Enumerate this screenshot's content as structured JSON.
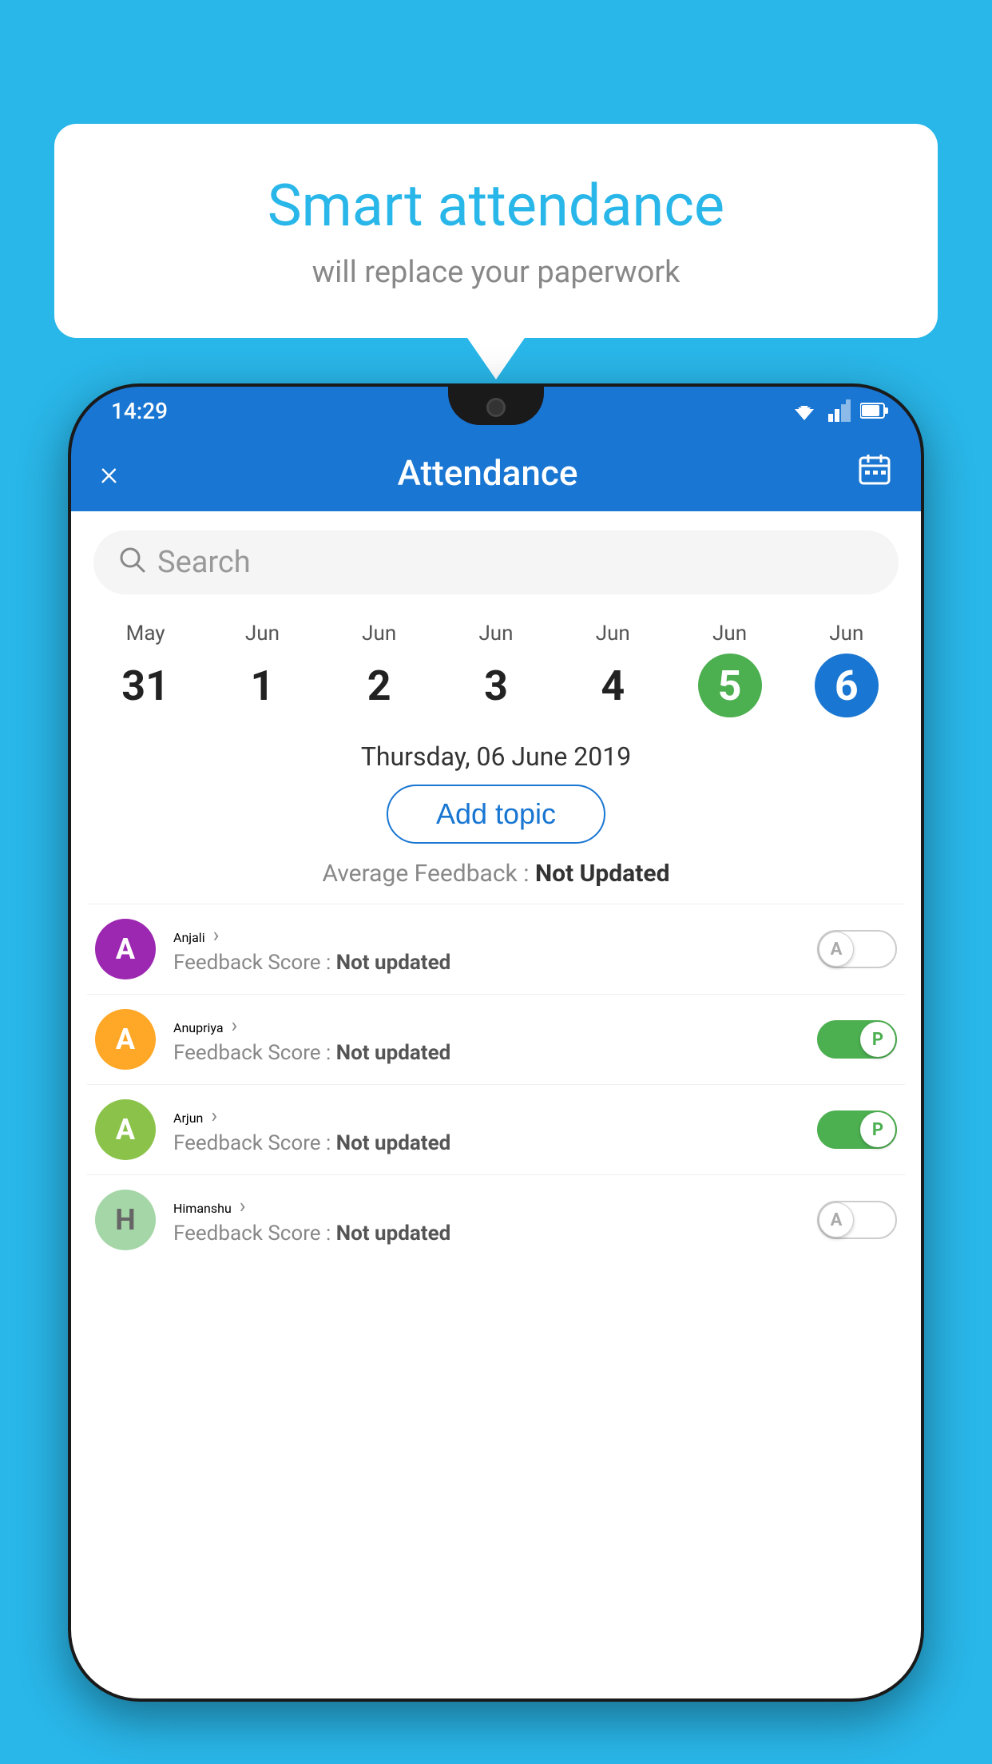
{
  "background_color": "#29b6e8",
  "speech_bubble": {
    "title": "Smart attendance",
    "subtitle": "will replace your paperwork"
  },
  "status_bar": {
    "time": "14:29"
  },
  "app_bar": {
    "title": "Attendance",
    "close_label": "×",
    "calendar_label": "📅"
  },
  "search": {
    "placeholder": "Search"
  },
  "dates": [
    {
      "month": "May",
      "day": "31",
      "type": "normal"
    },
    {
      "month": "Jun",
      "day": "1",
      "type": "normal"
    },
    {
      "month": "Jun",
      "day": "2",
      "type": "normal"
    },
    {
      "month": "Jun",
      "day": "3",
      "type": "normal"
    },
    {
      "month": "Jun",
      "day": "4",
      "type": "normal"
    },
    {
      "month": "Jun",
      "day": "5",
      "type": "today"
    },
    {
      "month": "Jun",
      "day": "6",
      "type": "selected"
    }
  ],
  "selected_date_label": "Thursday, 06 June 2019",
  "add_topic_label": "Add topic",
  "avg_feedback_label": "Average Feedback :",
  "avg_feedback_value": "Not Updated",
  "students": [
    {
      "name": "Anjali",
      "avatar_letter": "A",
      "avatar_color": "#9c27b0",
      "feedback_label": "Feedback Score :",
      "feedback_value": "Not updated",
      "toggle_state": "off",
      "toggle_letter": "A"
    },
    {
      "name": "Anupriya",
      "avatar_letter": "A",
      "avatar_color": "#ffa726",
      "feedback_label": "Feedback Score :",
      "feedback_value": "Not updated",
      "toggle_state": "on",
      "toggle_letter": "P"
    },
    {
      "name": "Arjun",
      "avatar_letter": "A",
      "avatar_color": "#8bc34a",
      "feedback_label": "Feedback Score :",
      "feedback_value": "Not updated",
      "toggle_state": "on",
      "toggle_letter": "P"
    },
    {
      "name": "Himanshu",
      "avatar_letter": "H",
      "avatar_color": "#a5d6a7",
      "feedback_label": "Feedback Score :",
      "feedback_value": "Not updated",
      "toggle_state": "off",
      "toggle_letter": "A"
    }
  ]
}
